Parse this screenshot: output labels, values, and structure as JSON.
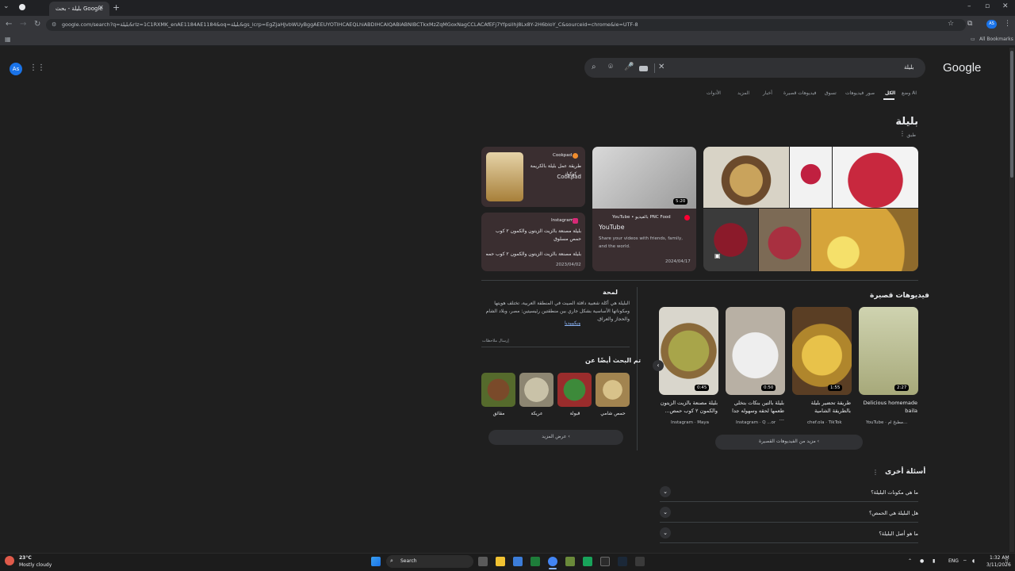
{
  "browser": {
    "tab_title": "بليلة - بحث Google",
    "url": "google.com/search?q=بليلة&rlz=1C1RXMK_enAE1184AE1184&oq=بليلة&gs_lcrp=EgZjaHJvbWUyBggAEEUYOTIHCAEQLhiABDIHCAIQABiABNIBCTkxMzZqMGoxNagCCLACAfEFj7Yfpsilhj8Lx8Y-2H6bloY_C&sourceid=chrome&ie=UTF-8",
    "all_bookmarks": "All Bookmarks",
    "profile": "AS"
  },
  "google": {
    "logo": "Google",
    "query": "بليلة",
    "filters": [
      "وضع AI",
      "الكل",
      "صور",
      "فيديوهات",
      "تسوق",
      "فيديوهات قصيرة",
      "أخبار",
      "المزيد",
      "الأدوات"
    ],
    "avatar": "As"
  },
  "entity": {
    "title": "بليلة",
    "subtitle": "طبق"
  },
  "cards": {
    "cookpad": {
      "source": "Cookpad",
      "snippet": "طريقة عمل بليلة بالكريمة .. كوكباد",
      "site": "Cookpad"
    },
    "instagram": {
      "source": "Instagram",
      "line1": "بليلة مصنعة بالزيت الزيتون والكمون ٢ كوب حمص مسلوق",
      "line2": "بليلة مصنعة بالزيت الزيتون والكمون ٢ كوب حمص مسلو...",
      "date": "2023/04/02"
    },
    "youtube": {
      "source": "YouTube • بالفيديو PNC Food",
      "duration": "5:20",
      "title": "YouTube",
      "desc": "Share your videos with friends, family, and the world.",
      "date": "2024/04/17"
    }
  },
  "overview": {
    "title": "لمحة",
    "text": "البليلة هي أكلة شعبية دافئة الصيت في المنطقة العربية، تختلف هويتها ومكوناتها الأساسية بشكل جاري بين منطقتين رئيسيتين: مصر، وبلاد الشام والحجاز والعراق.",
    "wiki": "ويكيبيديا",
    "feedback": "إرسال ملاحظات"
  },
  "related": {
    "title": "تم البحث أيضًا عن",
    "items": [
      "حمص شامي",
      "قبولة",
      "عريكة",
      "مقائق"
    ],
    "more": "عرض المزيد"
  },
  "shorts": {
    "title": "فيديوهات قصيرة",
    "items": [
      {
        "duration": "2:27",
        "caption": "Delicious homemade baila",
        "source": "YouTube · مطبخ ام..."
      },
      {
        "duration": "1:55",
        "caption": "طريقة تحضير بليلة بالطريقة الشامية",
        "source": "chef.ola · TikTok"
      },
      {
        "duration": "0:50",
        "caption": "بليلة بالتين بنكات بتخلي طعمها لحقه وسهوله جدا ...",
        "source": "Instagram · Q ...or"
      },
      {
        "duration": "0:45",
        "caption": "بليلة مصنعة بالزيت الزيتون والكمون ٢ كوب حمص...",
        "source": "Instagram · Maya"
      }
    ],
    "more": "مزيد من الفيديوهات القصيرة"
  },
  "faq": {
    "title": "أسئلة أخرى",
    "items": [
      "ما هي مكونات البليلة؟",
      "هل البليلة هي الحمص؟",
      "ما هو أصل البليلة؟"
    ]
  },
  "taskbar": {
    "weather_temp": "23°C",
    "weather_desc": "Mostly cloudy",
    "search": "Search",
    "time": "1:32 AM",
    "date": "3/11/2026",
    "lang": "ENG"
  }
}
